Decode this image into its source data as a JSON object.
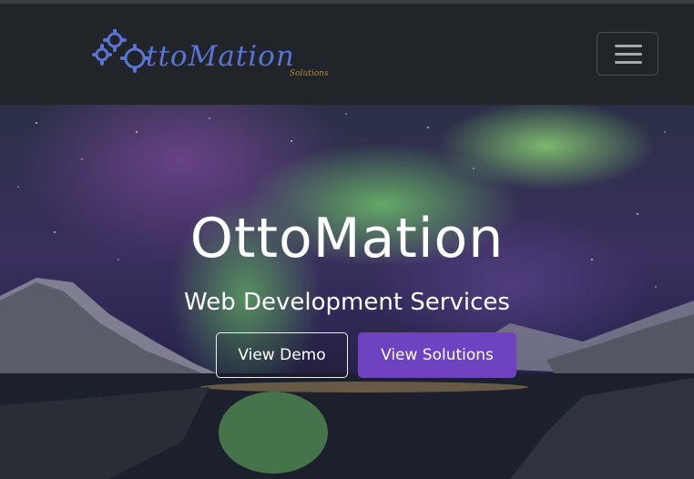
{
  "brand": {
    "logo_text": "ttoMation",
    "logo_sub": "Solutions",
    "color": "#5a73d6",
    "sub_color": "#b78a3e"
  },
  "nav": {
    "toggler_icon": "hamburger-icon"
  },
  "hero": {
    "title": "OttoMation",
    "subtitle": "Web Development Services",
    "buttons": {
      "demo_label": "View Demo",
      "solutions_label": "View Solutions"
    }
  },
  "colors": {
    "navbar": "#212529",
    "accent": "#6f42c1"
  }
}
